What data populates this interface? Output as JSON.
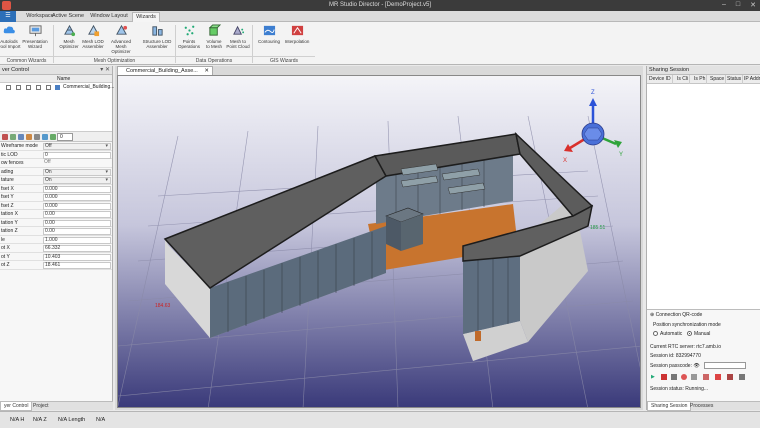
{
  "window": {
    "title": "MR Studio Director - [DemoProject.v5]"
  },
  "ribbon_tabs": [
    "Workspace",
    "Active Scene",
    "Window Layout",
    "Wizards"
  ],
  "ribbon_active_tab": "Wizards",
  "ribbon_buttons": {
    "autolods": "Autolods\nPool Import",
    "presentation": "Presentation\nWizard",
    "mesh_optimizer": "Mesh\nOptimizer",
    "mesh_lod": "Mesh LOD\nAssembler",
    "advanced_mesh": "Advanced Mesh\nOptimizer",
    "structure_lod": "Structure LOD\nAssembler",
    "points_ops": "Points\nOperations",
    "volume_mesh": "Volume\nto Mesh",
    "mesh_cloud": "Mesh to\nPoint Cloud",
    "contouring": "Contouring",
    "interpolation": "Interpolation"
  },
  "ribbon_groups": [
    "Common Wizards",
    "Mesh Optimization",
    "Data Operations",
    "GIS Wizards"
  ],
  "left_panel": {
    "title": "ver Control",
    "tree_column": "Name",
    "tree_item": "Commercial_Building...",
    "spin_value": "0",
    "properties": [
      {
        "label": "Wireframe mode",
        "value": "Off",
        "kind": "dropdown"
      },
      {
        "label": "tic LOD",
        "value": "0",
        "kind": "text"
      },
      {
        "label": "ow fences",
        "value": "Off",
        "kind": "readonly"
      },
      {
        "label": "ading",
        "value": "On",
        "kind": "dropdown"
      },
      {
        "label": "tature",
        "value": "On",
        "kind": "dropdown"
      },
      {
        "label": "fset X",
        "value": "0.000",
        "kind": "text"
      },
      {
        "label": "fset Y",
        "value": "0.000",
        "kind": "text"
      },
      {
        "label": "fset Z",
        "value": "0.000",
        "kind": "text"
      },
      {
        "label": "tation X",
        "value": "0.00",
        "kind": "text"
      },
      {
        "label": "tation Y",
        "value": "0.00",
        "kind": "text"
      },
      {
        "label": "tation Z",
        "value": "0.00",
        "kind": "text"
      },
      {
        "label": "le",
        "value": "1.000",
        "kind": "text"
      },
      {
        "label": "ot X",
        "value": "66.332",
        "kind": "text"
      },
      {
        "label": "ot Y",
        "value": "10.403",
        "kind": "text"
      },
      {
        "label": "ot Z",
        "value": "18.461",
        "kind": "text"
      }
    ],
    "bottom_tabs": [
      "yer Control",
      "Project"
    ]
  },
  "viewport": {
    "tab_label": "Commercial_Building_Asse...",
    "dimension_left": "184.63",
    "dimension_right": "185.51",
    "axes": {
      "x": "X",
      "y": "Y",
      "z": "Z"
    }
  },
  "right_panel": {
    "title": "Sharing Session",
    "columns": [
      "Device ID",
      "Is Cli",
      "Is Ph",
      "Space",
      "Status",
      "IP Addre"
    ],
    "connection_header": "Connection QR-code",
    "sync_mode_label": "Position synchronization mode",
    "sync_options": [
      "Automatic",
      "Manual"
    ],
    "sync_selected": "Manual",
    "rtc_server": "Current RTC server: rtc7.amb.io",
    "session_id": "Session id: 832994770",
    "passcode_label": "Session passcode:",
    "session_status": "Session status:   Running...",
    "bottom_tabs": [
      "Sharing Session",
      "Processes"
    ]
  },
  "status_bar": [
    "N/A H",
    "N/A Z",
    "N/A Length",
    "N/A"
  ],
  "colors": {
    "accent": "#2c6fb8",
    "viewport_top": "#f4f4f8",
    "viewport_bottom": "#3a3a7a",
    "axis_x": "#d9302c",
    "axis_y": "#2fa43a",
    "axis_z": "#2b52d8"
  }
}
